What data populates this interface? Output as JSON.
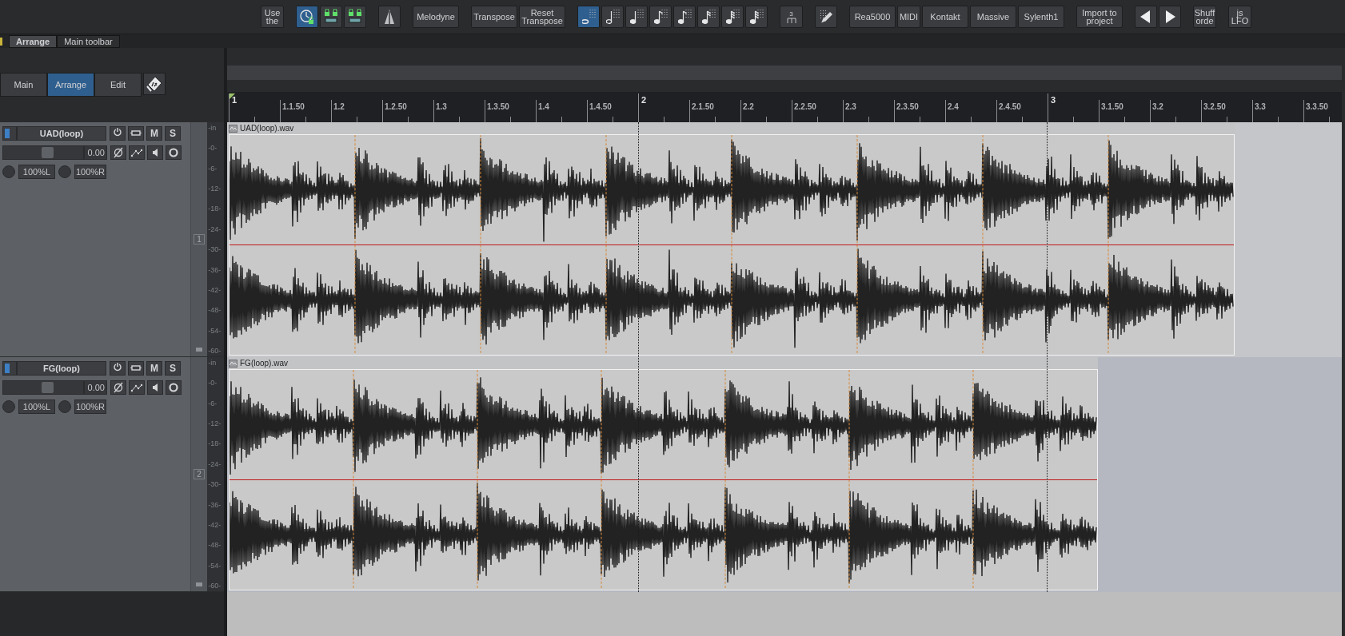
{
  "toolbar": {
    "groups": [
      [
        {
          "kind": "short-label",
          "label": "Use the",
          "active": false
        }
      ],
      [
        {
          "kind": "clock-lock",
          "active": true
        },
        {
          "kind": "lock-pair",
          "active": false
        },
        {
          "kind": "lock-pair",
          "active": false
        }
      ],
      [
        {
          "kind": "metronome",
          "active": false
        }
      ],
      [
        {
          "kind": "label",
          "label": "Melodyne",
          "active": false
        }
      ],
      [
        {
          "kind": "label",
          "label": "Transpose",
          "active": false
        },
        {
          "kind": "label",
          "label": "Reset Transpose",
          "active": false
        }
      ],
      [
        {
          "kind": "note-grid",
          "active": true
        },
        {
          "kind": "note-half",
          "active": false
        },
        {
          "kind": "note-quarter",
          "active": false
        },
        {
          "kind": "note-eighth",
          "active": false
        },
        {
          "kind": "note-eighth",
          "active": false
        },
        {
          "kind": "note-sixteenth",
          "active": false
        },
        {
          "kind": "note-thirtysecond",
          "active": false
        },
        {
          "kind": "note-thirtysecond",
          "active": false
        }
      ],
      [
        {
          "kind": "triplet",
          "label": "3",
          "active": false
        }
      ],
      [
        {
          "kind": "pencil",
          "active": false
        }
      ],
      [
        {
          "kind": "label",
          "label": "Rea5000",
          "active": false
        },
        {
          "kind": "short-label",
          "label": "MIDI",
          "active": false
        },
        {
          "kind": "label",
          "label": "Kontakt",
          "active": false
        },
        {
          "kind": "label",
          "label": "Massive",
          "active": false
        },
        {
          "kind": "label",
          "label": "Sylenth1",
          "active": false
        }
      ],
      [
        {
          "kind": "label",
          "label": "Import to project",
          "active": false
        }
      ],
      [
        {
          "kind": "arrow-left",
          "active": false
        },
        {
          "kind": "arrow-right",
          "active": false
        }
      ],
      [
        {
          "kind": "short-label",
          "label": "Shuff orde",
          "active": false
        }
      ],
      [
        {
          "kind": "short-label",
          "label": "js LFO",
          "active": false
        }
      ]
    ]
  },
  "toolbar_tabs": [
    {
      "label": "Arrange",
      "selected": true
    },
    {
      "label": "Main toolbar",
      "selected": false
    }
  ],
  "mode_tabs": [
    {
      "label": "Main",
      "selected": false
    },
    {
      "label": "Arrange",
      "selected": true
    },
    {
      "label": "Edit",
      "selected": false
    }
  ],
  "ruler": {
    "labels": [
      "1",
      "1.1.50",
      "1.2",
      "1.2.50",
      "1.3",
      "1.3.50",
      "1.4",
      "1.4.50",
      "2",
      "2.1.50",
      "2.2",
      "2.2.50",
      "2.3",
      "2.3.50",
      "2.4",
      "2.4.50",
      "3",
      "3.1.50",
      "3.2",
      "3.2.50",
      "3.3",
      "3.3.50"
    ]
  },
  "tracks": [
    {
      "number": "1",
      "name": "UAD(loop)",
      "mute": "M",
      "solo": "S",
      "volume": "0.00",
      "level": 0.56,
      "pan": "100%L",
      "width": "100%R",
      "meter_scale": [
        "-in",
        "-0-",
        "-6-",
        "-12-",
        "-18-",
        "-24-",
        "-30-",
        "-36-",
        "-42-",
        "-48-",
        "-54-",
        "-60-"
      ],
      "item": {
        "name": "UAD(loop).wav"
      }
    },
    {
      "number": "2",
      "name": "FG(loop)",
      "mute": "M",
      "solo": "S",
      "volume": "0.00",
      "level": 0.56,
      "pan": "100%L",
      "width": "100%R",
      "meter_scale": [
        "-in",
        "-0-",
        "-6-",
        "-12-",
        "-18-",
        "-24-",
        "-30-",
        "-36-",
        "-42-",
        "-48-",
        "-54-",
        "-60-"
      ],
      "item": {
        "name": "FG(loop).wav"
      }
    }
  ]
}
